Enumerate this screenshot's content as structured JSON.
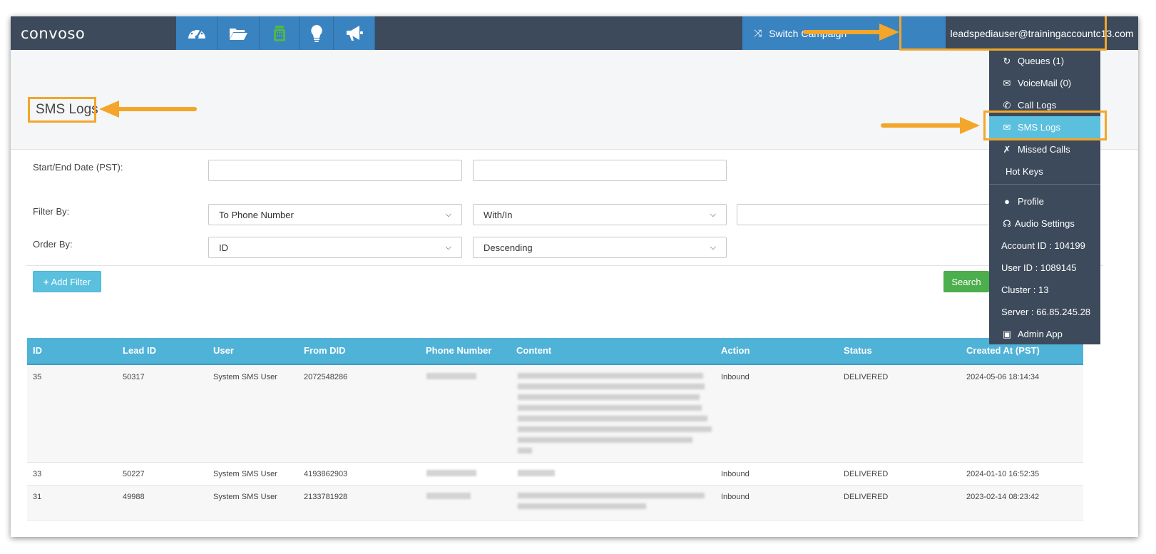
{
  "brand": {
    "logo_text": "convoso"
  },
  "nav": {
    "icons": [
      "dashboard-icon",
      "folder-icon",
      "phone-icon",
      "lightbulb-icon",
      "megaphone-icon"
    ],
    "switch_campaign_label": "Switch Campaign",
    "user_email": "leadspediauser@trainingaccountc13.com"
  },
  "page": {
    "title": "SMS Logs"
  },
  "form": {
    "date_label": "Start/End Date (PST):",
    "start_date_value": "",
    "end_date_value": "",
    "filter_label": "Filter By:",
    "filter_field": "To Phone Number",
    "filter_operator": "With/In",
    "filter_value": "",
    "order_label": "Order By:",
    "order_field": "ID",
    "order_direction": "Descending",
    "add_filter_label": "Add Filter",
    "search_label": "Search"
  },
  "table": {
    "columns": [
      "ID",
      "Lead ID",
      "User",
      "From DID",
      "Phone Number",
      "Content",
      "Action",
      "Status",
      "Created At (PST)"
    ],
    "rows": [
      {
        "id": "35",
        "lead_id": "50317",
        "user": "System SMS User",
        "from_did": "2072548286",
        "phone": "",
        "content": "",
        "action": "Inbound",
        "status": "DELIVERED",
        "created": "2024-05-06 18:14:34"
      },
      {
        "id": "33",
        "lead_id": "50227",
        "user": "System SMS User",
        "from_did": "4193862903",
        "phone": "",
        "content": "",
        "action": "Inbound",
        "status": "DELIVERED",
        "created": "2024-01-10 16:52:35"
      },
      {
        "id": "31",
        "lead_id": "49988",
        "user": "System SMS User",
        "from_did": "2133781928",
        "phone": "",
        "content": "",
        "action": "Inbound",
        "status": "DELIVERED",
        "created": "2023-02-14 08:23:42"
      }
    ]
  },
  "user_menu": {
    "items": [
      {
        "label": "Queues (1)",
        "icon": "refresh-icon"
      },
      {
        "label": "VoiceMail (0)",
        "icon": "envelope-icon"
      },
      {
        "label": "Call Logs",
        "icon": "phone-icon"
      },
      {
        "label": "SMS Logs",
        "icon": "envelope-icon"
      },
      {
        "label": "Missed Calls",
        "icon": "missed-call-icon"
      },
      {
        "label": "Hot Keys",
        "icon": ""
      },
      {
        "label": "Profile",
        "icon": "user-icon"
      },
      {
        "label": "Audio Settings",
        "icon": "headphones-icon"
      },
      {
        "label": "Account ID : 104199",
        "icon": ""
      },
      {
        "label": "User ID : 1089145",
        "icon": ""
      },
      {
        "label": "Cluster : 13",
        "icon": ""
      },
      {
        "label": "Server : 66.85.245.28",
        "icon": ""
      },
      {
        "label": "Admin App",
        "icon": "monitor-icon"
      }
    ]
  },
  "colors": {
    "navbar": "#3c4a5b",
    "nav_button": "#3a83c1",
    "table_header": "#4fb2d7",
    "active_menu": "#5bc0de",
    "search_button": "#4cae4c",
    "annotation": "#f3a62a"
  }
}
